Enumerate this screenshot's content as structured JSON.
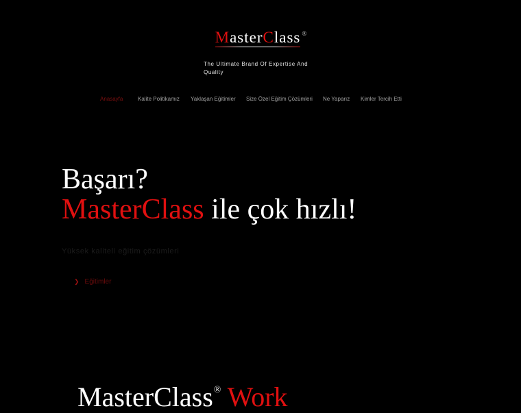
{
  "logo": {
    "first_cap": "M",
    "first_rest": "aster",
    "second_cap": "C",
    "second_rest": "lass",
    "reg": "®"
  },
  "tagline": "The Ultimate Brand Of Expertise And Quality",
  "nav": {
    "items": [
      {
        "label": "Anasayfa",
        "active": true
      },
      {
        "label": "Kalite Politikamız"
      },
      {
        "label": "Yaklaşan Eğitimler"
      },
      {
        "label": "Size Özel Eğitim Çözümleri"
      },
      {
        "label": "Ne Yaparız"
      },
      {
        "label": "Kimler Tercih Etti"
      }
    ]
  },
  "hero": {
    "line1": "Başarı?",
    "line2_brand": "MasterClass",
    "line2_rest": " ile çok hızlı!",
    "subtitle": "Yüksek kaliteli eğitim çözümleri",
    "cta_label": "Eğitimler",
    "cta_icon": "chevron-right-icon"
  },
  "work": {
    "brand": "MasterClass",
    "reg": "®",
    "word": " Work"
  },
  "colors": {
    "accent": "#e01010",
    "background": "#000000",
    "active_nav": "#7a0f0f"
  }
}
